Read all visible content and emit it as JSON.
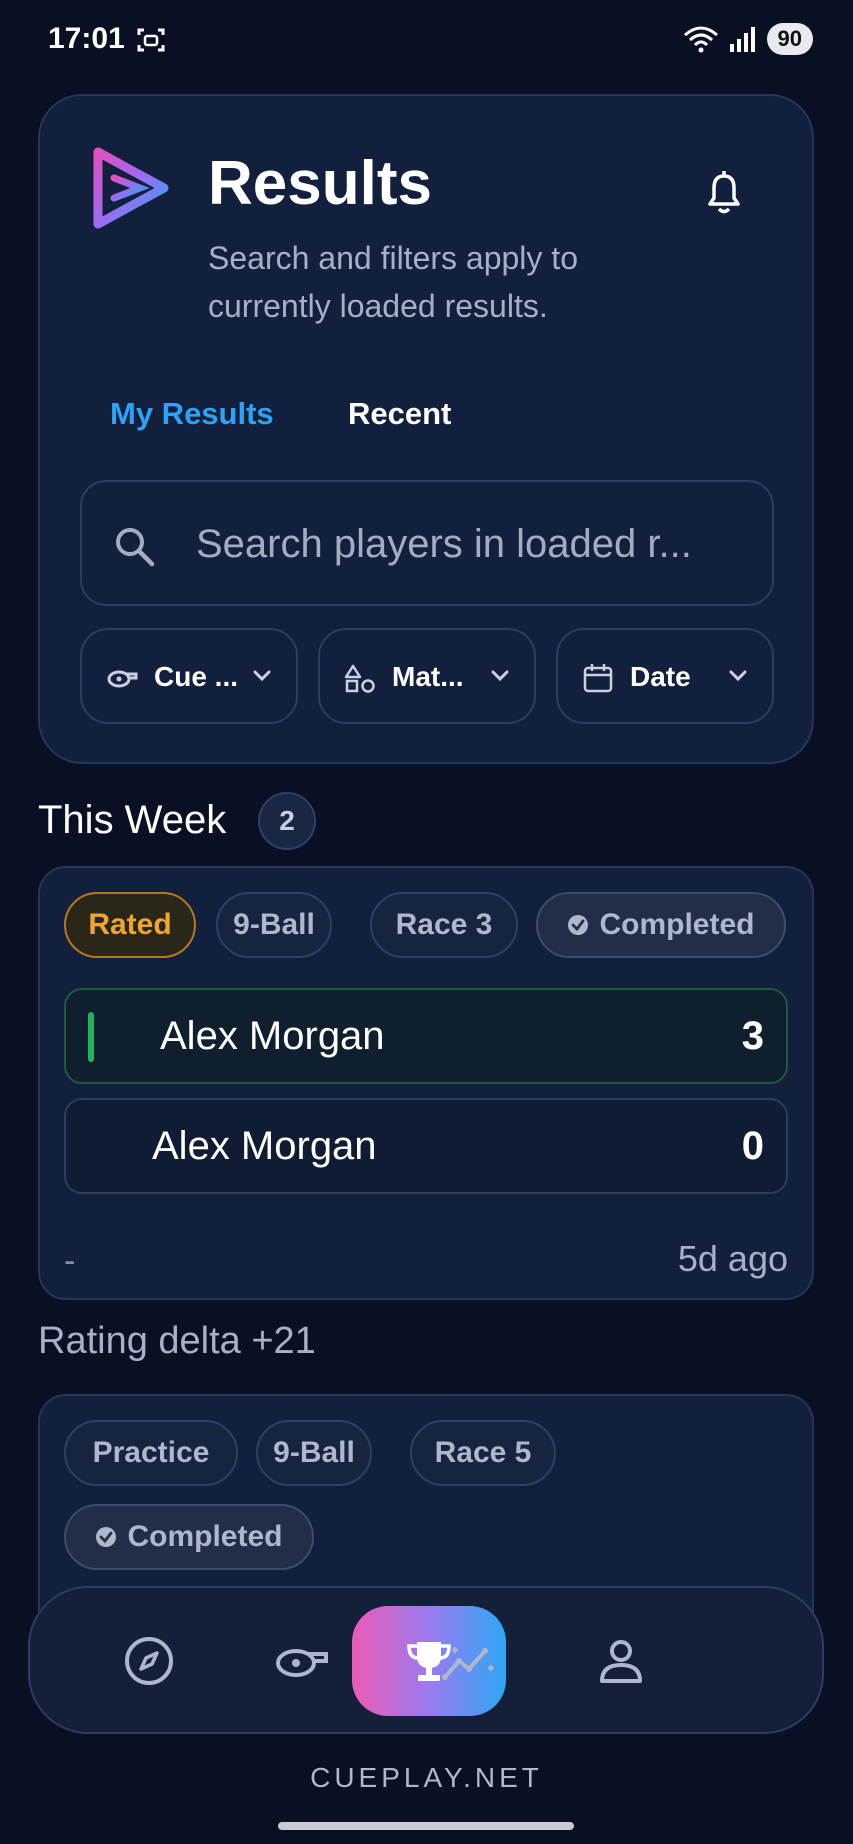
{
  "status_bar": {
    "time": "17:01",
    "battery": "90"
  },
  "header": {
    "title": "Results",
    "subtitle": "Search and filters apply to currently loaded results."
  },
  "tabs": [
    {
      "label": "My Results",
      "active": true
    },
    {
      "label": "Recent",
      "active": false
    }
  ],
  "search": {
    "placeholder": "Search players in loaded r..."
  },
  "filters": [
    {
      "label": "Cue ...",
      "icon": "cue-icon"
    },
    {
      "label": "Mat...",
      "icon": "shapes-icon"
    },
    {
      "label": "Date",
      "icon": "calendar-icon"
    }
  ],
  "section": {
    "title": "This Week",
    "count": "2"
  },
  "matches": [
    {
      "chips": [
        "Rated",
        "9-Ball",
        "Race 3",
        "Completed"
      ],
      "players": [
        {
          "name": "Alex Morgan",
          "score": "3",
          "winner": true
        },
        {
          "name": "Alex Morgan",
          "score": "0",
          "winner": false
        }
      ],
      "footer_left": "-",
      "footer_right": "5d ago"
    },
    {
      "chips": [
        "Practice",
        "9-Ball",
        "Race 5",
        "Completed"
      ]
    }
  ],
  "rating_delta": "Rating delta +21",
  "nav": [
    "compass-icon",
    "cue-icon",
    "trophy-icon",
    "stats-icon",
    "profile-icon"
  ],
  "brand": "CUEPLAY.NET",
  "colors": {
    "accent_blue": "#2ea3f5",
    "rated": "#f0a431",
    "win": "#22b45a",
    "bg": "#0a1024"
  }
}
